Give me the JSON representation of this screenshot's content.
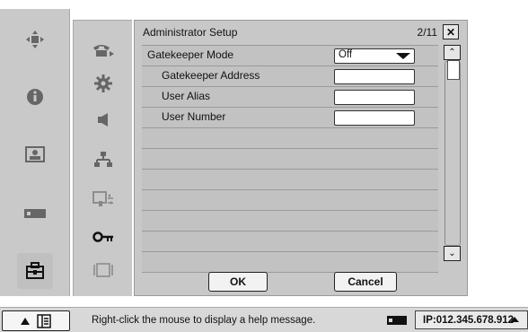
{
  "dialog": {
    "title": "Administrator Setup",
    "page": "2/11",
    "close_label": "✕",
    "rows": [
      {
        "label": "Gatekeeper Mode",
        "control": "select",
        "value": "Off"
      },
      {
        "label": "Gatekeeper Address",
        "control": "text",
        "value": ""
      },
      {
        "label": "User Alias",
        "control": "text",
        "value": ""
      },
      {
        "label": "User Number",
        "control": "text",
        "value": ""
      }
    ],
    "ok_label": "OK",
    "cancel_label": "Cancel",
    "scroll_up_label": "⌃",
    "scroll_down_label": "⌄"
  },
  "left_sidebar": {
    "items": [
      "camera-control-icon",
      "info-icon",
      "picture-icon",
      "network-card-icon",
      "admin-toolbox-icon"
    ]
  },
  "sub_sidebar": {
    "items": [
      "telephone-icon",
      "gear-icon",
      "speaker-icon",
      "network-icon",
      "video-audio-icon",
      "key-icon",
      "monitor-icon"
    ],
    "selected": "key-icon"
  },
  "status_bar": {
    "help_text": "Right-click the mouse to display a help message.",
    "ip_text": "IP:012.345.678.912"
  }
}
